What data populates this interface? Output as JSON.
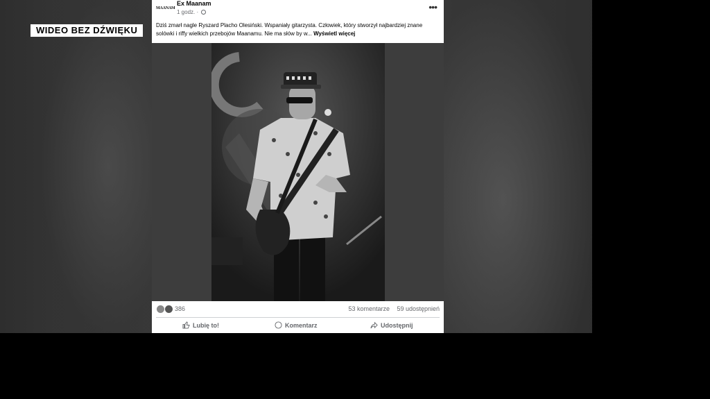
{
  "overlay": {
    "badge": "WIDEO BEZ DŹWIĘKU"
  },
  "post": {
    "page_logo_text": "MAANAM",
    "page_name": "Ex Maanam",
    "time": "1 godz.",
    "text": "Dziś zmarł nagle Ryszard Placho Olesiński. Wspaniały gitarzysta. Człowiek, który stworzył najbardziej znane solówki i riffy wielkich przebojów Maanamu. Nie ma słów by w...",
    "see_more": "Wyświetl więcej",
    "image_icon": "guitarist-photo"
  },
  "stats": {
    "reactions_count": "386",
    "comments": "53 komentarze",
    "shares": "59 udostępnień"
  },
  "actions": {
    "like": "Lubię to!",
    "comment": "Komentarz",
    "share": "Udostępnij"
  },
  "colors": {
    "background": "#000000",
    "post_bg": "#ffffff",
    "muted_text": "#65676b"
  }
}
